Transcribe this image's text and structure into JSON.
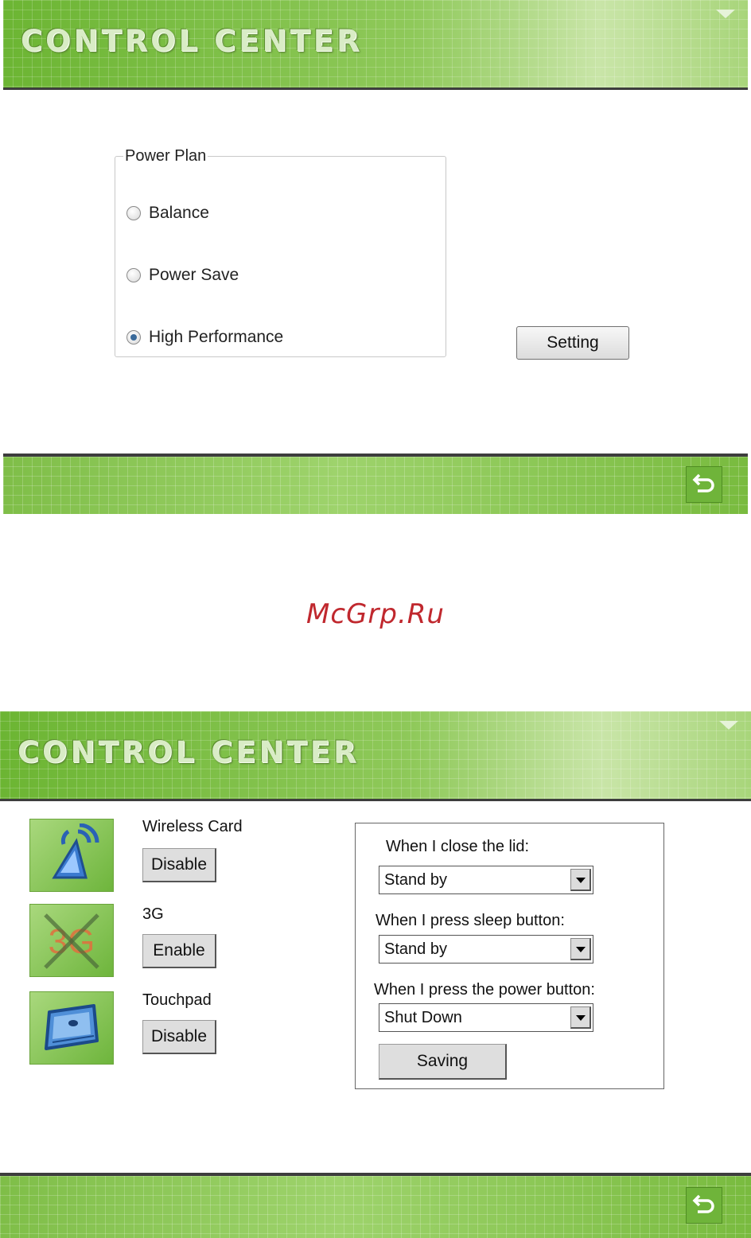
{
  "screen1": {
    "header": {
      "title": "CONTROL CENTER"
    },
    "power_plan": {
      "legend": "Power Plan",
      "options": [
        {
          "label": "Balance",
          "selected": false
        },
        {
          "label": "Power Save",
          "selected": false
        },
        {
          "label": "High Performance",
          "selected": true
        }
      ],
      "setting_button": "Setting"
    }
  },
  "watermark": "McGrp.Ru",
  "screen2": {
    "header": {
      "title": "CONTROL CENTER"
    },
    "devices": [
      {
        "label": "Wireless Card",
        "button": "Disable",
        "icon": "wireless-antenna-icon"
      },
      {
        "label": "3G",
        "button": "Enable",
        "icon": "3g-disabled-icon"
      },
      {
        "label": "Touchpad",
        "button": "Disable",
        "icon": "touchpad-icon"
      }
    ],
    "power_actions": {
      "lid_label": "When I close the lid:",
      "lid_value": "Stand by",
      "sleep_label": "When I press sleep button:",
      "sleep_value": "Stand by",
      "power_label": "When I press the power button:",
      "power_value": "Shut Down",
      "saving_button": "Saving"
    }
  },
  "colors": {
    "header_green": "#7dbd45",
    "footer_green": "#86c34e",
    "watermark_red": "#c0282e"
  }
}
